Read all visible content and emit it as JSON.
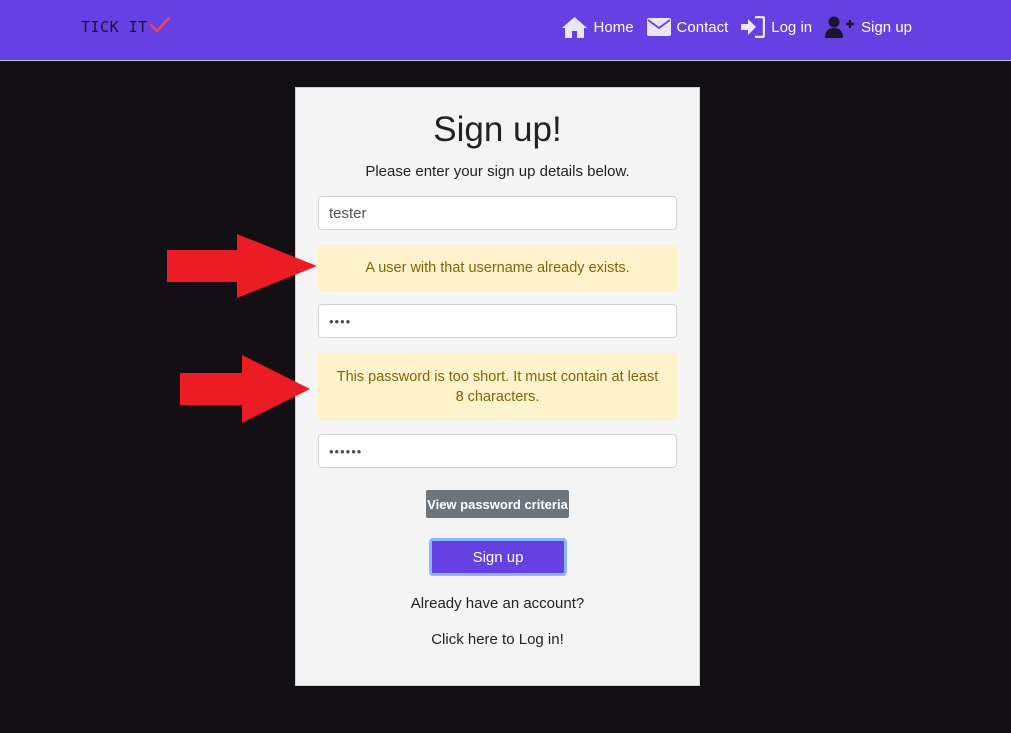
{
  "nav": {
    "brand": "TICK IT",
    "links": [
      {
        "label": "Home",
        "icon": "home-icon"
      },
      {
        "label": "Contact",
        "icon": "envelope-icon"
      },
      {
        "label": "Log in",
        "icon": "sign-in-icon"
      },
      {
        "label": "Sign up",
        "icon": "user-plus-icon"
      }
    ]
  },
  "form": {
    "title": "Sign up!",
    "subtitle": "Please enter your sign up details below.",
    "username_value": "tester",
    "username_error": "A user with that username already exists.",
    "password1_value": "••••",
    "password_error": "This password is too short. It must contain at least 8 characters.",
    "password2_value": "••••••",
    "criteria_button": "View password criteria",
    "submit_button": "Sign up",
    "already_text": "Already have an account?",
    "login_link": "Click here to Log in!"
  },
  "colors": {
    "navbar": "#6540e3",
    "background": "#121015",
    "alert_bg": "#fff3cd",
    "alert_text": "#856404",
    "arrow": "#ec1c24"
  }
}
